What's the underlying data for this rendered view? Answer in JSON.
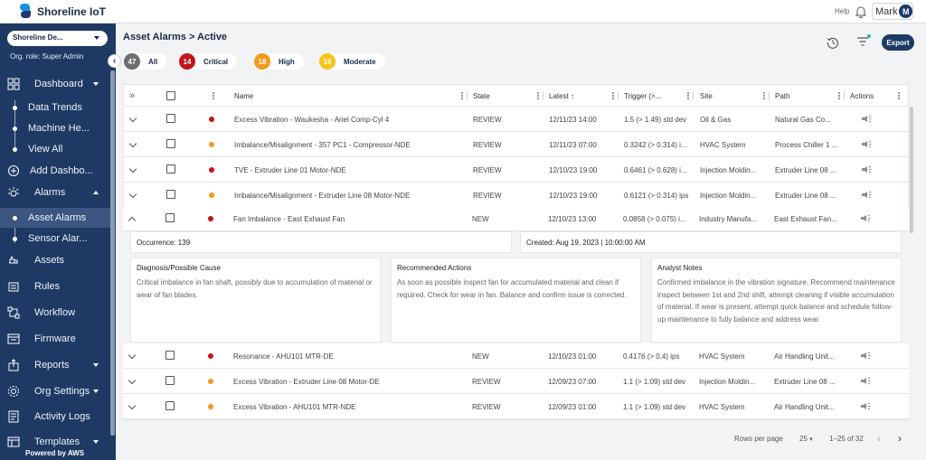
{
  "app": {
    "name": "Shoreline IoT"
  },
  "topbar": {
    "help": "Help",
    "user_name": "Mark",
    "user_initial": "M"
  },
  "sidebar": {
    "org_select": "Shoreline De...",
    "org_role": "Org. role: Super Admin",
    "items": [
      {
        "label": "Dashboard",
        "icon": "dashboard-icon"
      },
      {
        "label": "Data Trends"
      },
      {
        "label": "Machine He..."
      },
      {
        "label": "View All"
      },
      {
        "label": "Add Dashbo...",
        "icon": "plus-circle-icon"
      },
      {
        "label": "Alarms",
        "icon": "alarm-icon"
      },
      {
        "label": "Asset Alarms"
      },
      {
        "label": "Sensor Alar..."
      },
      {
        "label": "Assets",
        "icon": "assets-icon"
      },
      {
        "label": "Rules",
        "icon": "rules-icon"
      },
      {
        "label": "Workflow",
        "icon": "workflow-icon"
      },
      {
        "label": "Firmware",
        "icon": "firmware-icon"
      },
      {
        "label": "Reports",
        "icon": "reports-icon"
      },
      {
        "label": "Org Settings",
        "icon": "org-settings-icon"
      },
      {
        "label": "Activity Logs",
        "icon": "activity-logs-icon"
      },
      {
        "label": "Templates",
        "icon": "templates-icon"
      }
    ],
    "powered_by": "Powered by AWS"
  },
  "page": {
    "title": "Asset Alarms > Active",
    "export": "Export"
  },
  "chips": [
    {
      "count": "47",
      "label": "All",
      "color": "#6b6e73"
    },
    {
      "count": "14",
      "label": "Critical",
      "color": "#c0161c"
    },
    {
      "count": "18",
      "label": "High",
      "color": "#f39a1e"
    },
    {
      "count": "15",
      "label": "Moderate",
      "color": "#f6c518"
    }
  ],
  "columns": [
    "Name",
    "State",
    "Latest",
    "Trigger (>...",
    "Site",
    "Path",
    "Actions"
  ],
  "rows_before": [
    {
      "name": "Excess Vibration - Waukesha - Ariel Comp-Cyl 4",
      "state": "REVIEW",
      "latest": "12/11/23 14:00",
      "trigger": "1.5 (> 1.49) std dev",
      "site": "Oil & Gas",
      "path": "Natural Gas Co...",
      "severity": "#c0161c"
    },
    {
      "name": "Imbalance/Misalignment - 357 PC1 - Compressor-NDE",
      "state": "REVIEW",
      "latest": "12/11/23 07:00",
      "trigger": "0.3242 (> 0.314) i...",
      "site": "HVAC System",
      "path": "Process Chiller 1 ...",
      "severity": "#f39a1e"
    },
    {
      "name": "TVE - Extruder Line 01 Motor-NDE",
      "state": "REVIEW",
      "latest": "12/10/23 19:00",
      "trigger": "0.6461 (> 0.628) i...",
      "site": "Injection Moldin...",
      "path": "Extruder Line 08 ...",
      "severity": "#c0161c"
    },
    {
      "name": "Imbalance/Misalignment - Extruder Line 08 Motor-NDE",
      "state": "REVIEW",
      "latest": "12/10/23 19:00",
      "trigger": "0.6121 (> 0.314) ips",
      "site": "Injection Moldin...",
      "path": "Extruder Line 08 ...",
      "severity": "#f39a1e"
    },
    {
      "name": "Fan Imbalance - East Exhaust Fan",
      "state": "NEW",
      "latest": "12/10/23 13:00",
      "trigger": "0.0858 (> 0.075) i...",
      "site": "Industry Manufa...",
      "path": "East Exhaust Fan...",
      "severity": "#c0161c"
    }
  ],
  "detail": {
    "occurrence": "Occurrence: 139",
    "created": "Created: Aug 19, 2023 | 10:00:00 AM",
    "diagnosis_title": "Diagnosis/Possible Cause",
    "diagnosis_text": "Critical imbalance in fan shaft, possibly due to accumulation of material or wear of fan blades.",
    "actions_title": "Recommended Actions",
    "actions_text": "As soon as possible inspect fan for accumulated material and clean if required. Check for wear in fan. Balance and confirm issue is corrected.",
    "notes_title": "Analyst Notes",
    "notes_text": "Confirmed imbalance in the vibration signature. Recommend maintenance inspect between 1st and 2nd shift, attempt cleaning if visible accumulation of material. If wear is present, attempt quick balance and schedule follow-up maintenance to fully balance and address wear."
  },
  "rows_after": [
    {
      "name": "Resonance - AHU101 MTR-DE",
      "state": "NEW",
      "latest": "12/10/23 01:00",
      "trigger": "0.4176 (> 0.4) ips",
      "site": "HVAC System",
      "path": "Air Handling Unit...",
      "severity": "#c0161c"
    },
    {
      "name": "Excess Vibration - Extruder Line 08 Motor-DE",
      "state": "REVIEW",
      "latest": "12/09/23 07:00",
      "trigger": "1.1 (> 1.09) std dev",
      "site": "Injection Moldin...",
      "path": "Extruder Line 08 ...",
      "severity": "#f39a1e"
    },
    {
      "name": "Excess Vibration - AHU101 MTR-NDE",
      "state": "REVIEW",
      "latest": "12/09/23 01:00",
      "trigger": "1.1 (> 1.09) std dev",
      "site": "HVAC System",
      "path": "Air Handling Unit...",
      "severity": "#f39a1e"
    }
  ],
  "pagination": {
    "rows_per_page_label": "Rows per page",
    "rows_per_page": "25",
    "range": "1–25 of 32"
  }
}
